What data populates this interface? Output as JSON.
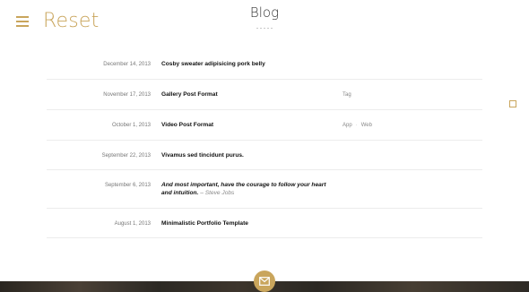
{
  "header": {
    "logo": "Reset",
    "page_title": "Blog"
  },
  "posts": [
    {
      "date": "December 14, 2013",
      "title": "Cosby sweater adipisicing pork belly",
      "tags": []
    },
    {
      "date": "November 17, 2013",
      "title": "Gallery Post Format",
      "tags": [
        "Tag"
      ]
    },
    {
      "date": "October 1, 2013",
      "title": "Video Post Format",
      "tags": [
        "App",
        "Web"
      ]
    },
    {
      "date": "September 22, 2013",
      "title": "Vivamus sed tincidunt purus.",
      "tags": []
    },
    {
      "date": "September 6, 2013",
      "title": "And most important, have the courage to follow your heart and intuition.",
      "quote_author": "– Steve Jobs",
      "tags": []
    },
    {
      "date": "August 1, 2013",
      "title": "Minimalistic Portfolio Template",
      "tags": []
    }
  ],
  "colors": {
    "accent": "#c9a55c",
    "footer": "#2e2a25"
  }
}
